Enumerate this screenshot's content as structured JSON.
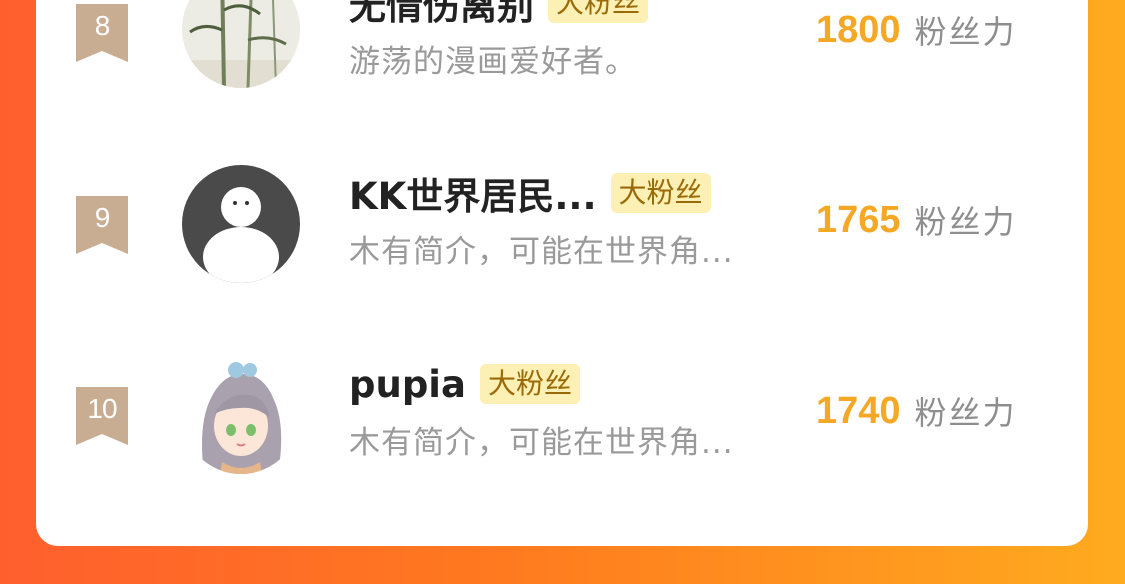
{
  "colors": {
    "accent_score": "#f4a826",
    "badge_bg": "#fdf0b4",
    "badge_text": "#9a6a08",
    "rank_ribbon": "#c9ad93",
    "background_from": "#ff5f2e",
    "background_to": "#ffab1f"
  },
  "fans": [
    {
      "rank": "8",
      "name": "无情伤离别",
      "badge": "大粉丝",
      "description": "游荡的漫画爱好者。",
      "score": "1800",
      "score_unit": "粉丝力",
      "avatar_icon": "bamboo-painting-avatar"
    },
    {
      "rank": "9",
      "name": "KK世界居民...",
      "badge": "大粉丝",
      "description": "木有简介，可能在世界角...",
      "score": "1765",
      "score_unit": "粉丝力",
      "avatar_icon": "default-user-avatar"
    },
    {
      "rank": "10",
      "name": "pupia",
      "badge": "大粉丝",
      "description": "木有简介，可能在世界角...",
      "score": "1740",
      "score_unit": "粉丝力",
      "avatar_icon": "anime-girl-avatar"
    }
  ]
}
